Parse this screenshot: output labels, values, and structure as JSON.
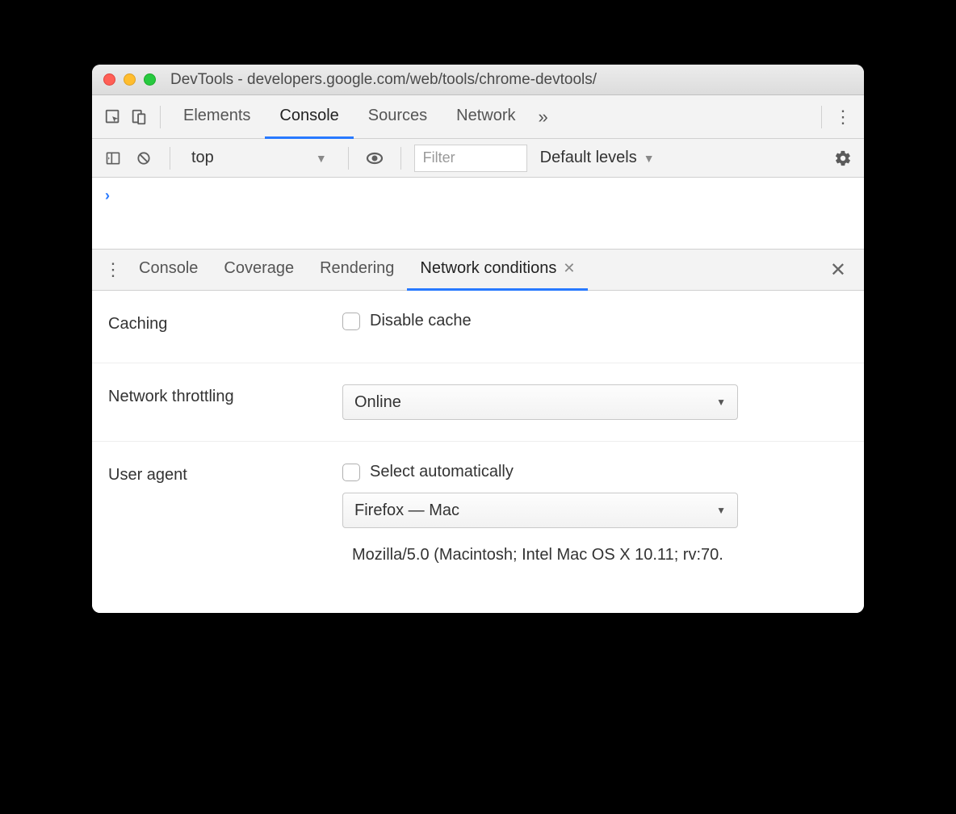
{
  "window": {
    "title": "DevTools - developers.google.com/web/tools/chrome-devtools/"
  },
  "mainTabs": {
    "elements": "Elements",
    "console": "Console",
    "sources": "Sources",
    "network": "Network"
  },
  "consoleToolbar": {
    "context": "top",
    "filterPlaceholder": "Filter",
    "levels": "Default levels"
  },
  "drawerTabs": {
    "console": "Console",
    "coverage": "Coverage",
    "rendering": "Rendering",
    "networkConditions": "Network conditions"
  },
  "networkConditions": {
    "cachingLabel": "Caching",
    "disableCache": "Disable cache",
    "throttlingLabel": "Network throttling",
    "throttlingValue": "Online",
    "userAgentLabel": "User agent",
    "selectAuto": "Select automatically",
    "uaSelectValue": "Firefox — Mac",
    "uaString": "Mozilla/5.0 (Macintosh; Intel Mac OS X 10.11; rv:70."
  }
}
